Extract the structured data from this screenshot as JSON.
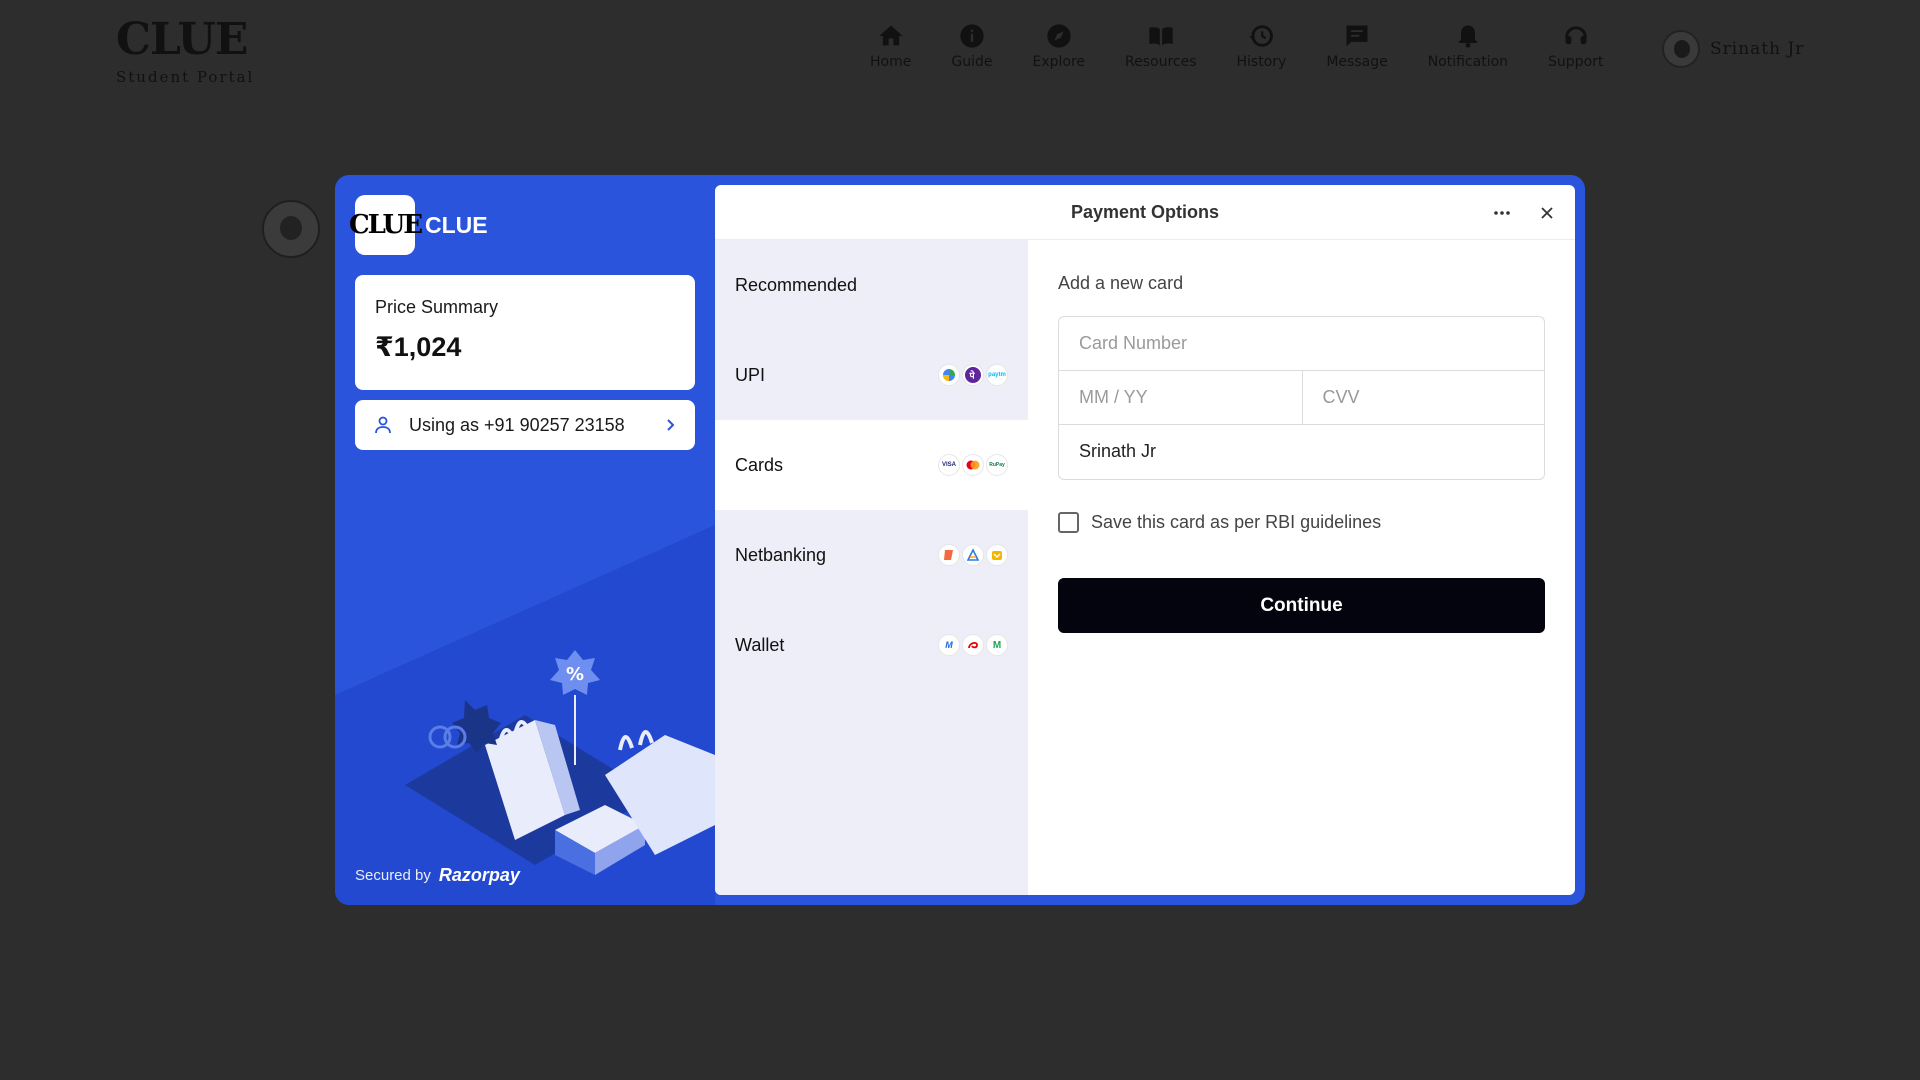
{
  "header": {
    "logo": "CLUE",
    "subtitle": "Student Portal",
    "nav": [
      {
        "label": "Home",
        "icon": "home-icon"
      },
      {
        "label": "Guide",
        "icon": "info-icon"
      },
      {
        "label": "Explore",
        "icon": "compass-icon"
      },
      {
        "label": "Resources",
        "icon": "book-icon"
      },
      {
        "label": "History",
        "icon": "history-icon"
      },
      {
        "label": "Message",
        "icon": "message-icon"
      },
      {
        "label": "Notification",
        "icon": "bell-icon"
      },
      {
        "label": "Support",
        "icon": "headset-icon"
      }
    ],
    "user_name": "Srinath Jr"
  },
  "checkout": {
    "merchant_logo": "CLUE",
    "merchant_name": "CLUE",
    "price_label": "Price Summary",
    "price_amount": "₹1,024",
    "using_as": "Using as +91 90257 23158",
    "secured_by": "Secured by",
    "provider": "Razorpay",
    "title": "Payment Options",
    "methods": [
      {
        "label": "Recommended"
      },
      {
        "label": "UPI",
        "logos": [
          "gpay",
          "phonepe",
          "paytm"
        ]
      },
      {
        "label": "Cards",
        "logos": [
          "VISA",
          "mastercard",
          "RuPay"
        ]
      },
      {
        "label": "Netbanking",
        "logos": [
          "bank1",
          "bank2",
          "bank3"
        ]
      },
      {
        "label": "Wallet",
        "logos": [
          "mobikwik",
          "airtel",
          "M"
        ]
      }
    ],
    "form": {
      "add_card_label": "Add a new card",
      "card_number_placeholder": "Card Number",
      "expiry_placeholder": "MM / YY",
      "cvv_placeholder": "CVV",
      "name_value": "Srinath Jr",
      "save_card_label": "Save this card as per RBI guidelines",
      "continue_label": "Continue"
    }
  },
  "colors": {
    "accent": "#2a54dc",
    "page_bg": "#2d2d2d",
    "button": "#03040d",
    "methods_bg": "#edeef8"
  }
}
